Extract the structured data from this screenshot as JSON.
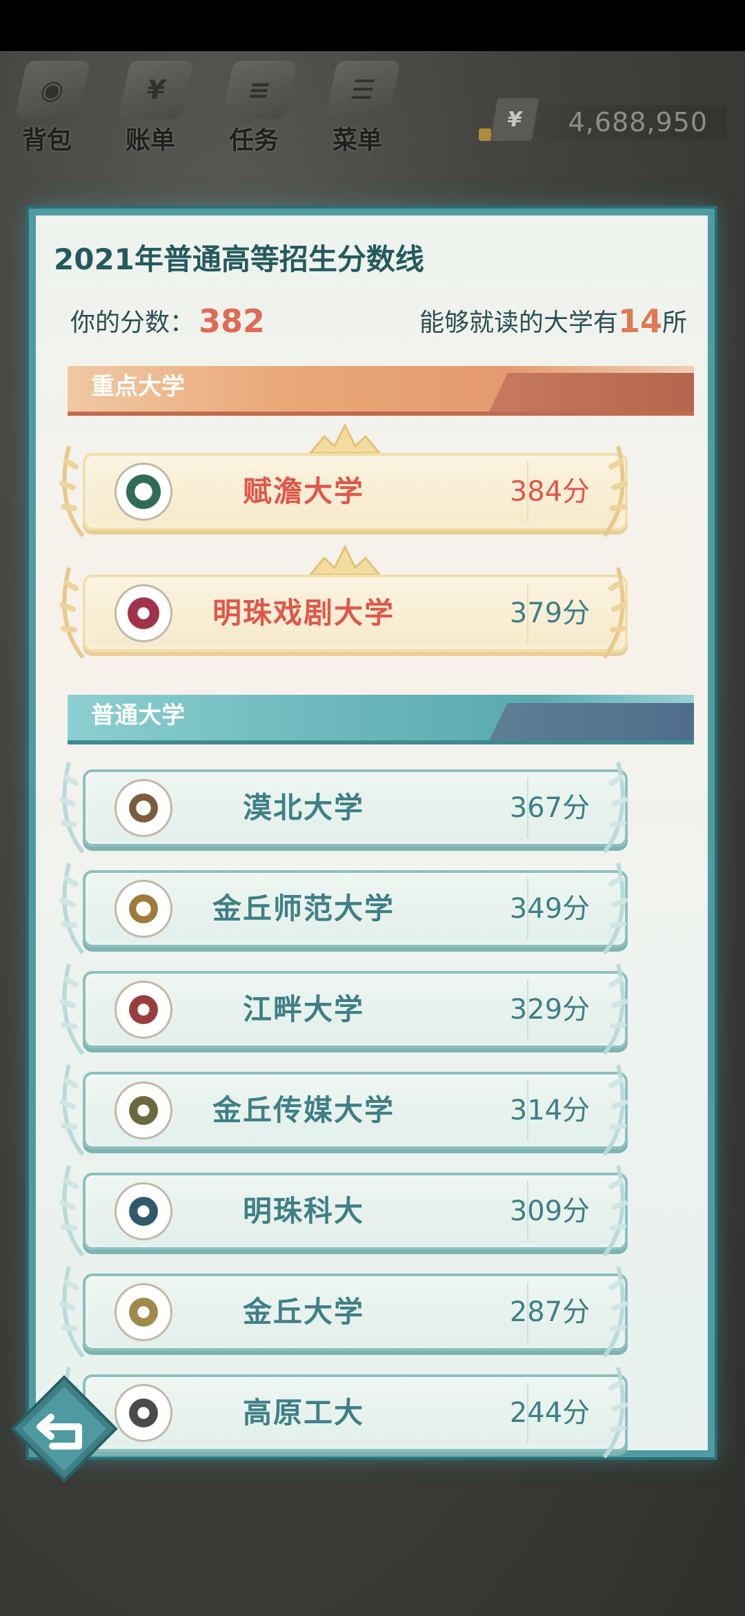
{
  "top_menu": {
    "items": [
      {
        "label": "背包",
        "icon": "backpack-icon"
      },
      {
        "label": "账单",
        "icon": "wallet-icon"
      },
      {
        "label": "任务",
        "icon": "task-book-icon"
      },
      {
        "label": "菜单",
        "icon": "menu-books-icon"
      }
    ],
    "money": {
      "symbol": "¥",
      "value": "4,688,950"
    }
  },
  "panel": {
    "title": "2021年普通高等招生分数线",
    "score_label": "你的分数：",
    "score_value": "382",
    "count_prefix": "能够就读的大学有",
    "count_value": "14",
    "count_suffix": "所"
  },
  "key_section": {
    "label": "重点大学",
    "universities": [
      {
        "name": "赋澹大学",
        "score": "384分",
        "above_user": true
      },
      {
        "name": "明珠戏剧大学",
        "score": "379分",
        "above_user": false
      }
    ]
  },
  "normal_section": {
    "label": "普通大学",
    "universities": [
      {
        "name": "漠北大学",
        "score": "367分"
      },
      {
        "name": "金丘师范大学",
        "score": "349分"
      },
      {
        "name": "江畔大学",
        "score": "329分"
      },
      {
        "name": "金丘传媒大学",
        "score": "314分"
      },
      {
        "name": "明珠科大",
        "score": "309分"
      },
      {
        "name": "金丘大学",
        "score": "287分"
      },
      {
        "name": "高原工大",
        "score": "244分"
      }
    ]
  },
  "colors": {
    "panel_border": "#4f9ca3",
    "key_accent": "#e0574a",
    "normal_text": "#3f7f86",
    "score_highlight": "#e06a55"
  }
}
